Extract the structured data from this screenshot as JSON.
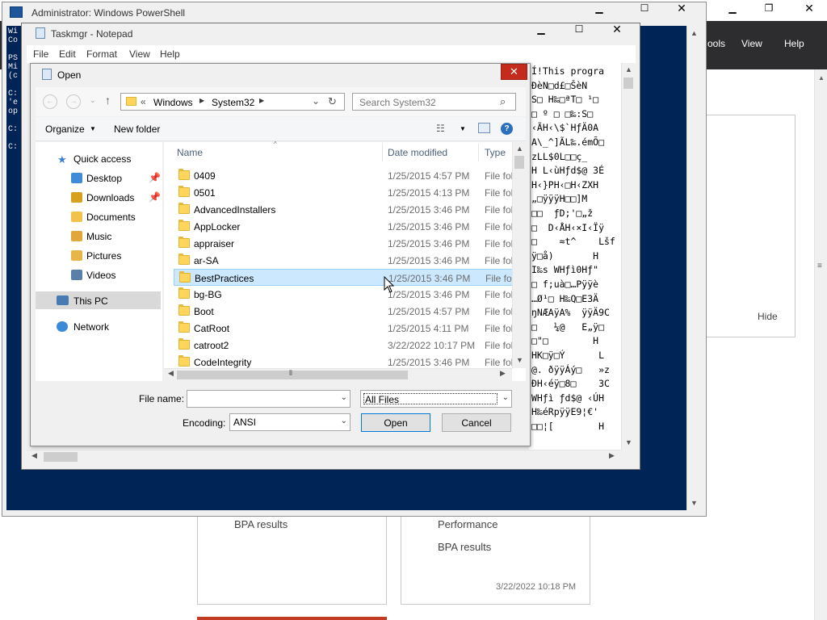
{
  "server_manager": {
    "menu": [
      "ools",
      "View",
      "Help"
    ],
    "hide_label": "Hide",
    "tile1": [
      "BPA results"
    ],
    "tile2": [
      "Performance",
      "BPA results"
    ],
    "tile2_time": "3/22/2022 10:18 PM"
  },
  "powershell": {
    "title": "Administrator: Windows PowerShell",
    "lines": [
      "Wi",
      "Co",
      "",
      "PS",
      "Mi",
      "(c",
      "",
      "C:",
      "'e",
      "op",
      "",
      "C:",
      "",
      "C:"
    ]
  },
  "notepad": {
    "title": "Taskmgr - Notepad",
    "menu": [
      "File",
      "Edit",
      "Format",
      "View",
      "Help"
    ],
    "text_lines": [
      "Í!This progra",
      "ÐèN□d£□ŠèN",
      "S□ H‰□ªT□ ¹□",
      "□ º □ □‰:S□",
      "‹ÃH‹\\$`HƒÄ0A",
      "A\\_^]ÃL‰.émÕ□",
      "zLL$0L□□ç_",
      "H L‹ùHƒd$@ 3É",
      "H‹}PH‹□H‹ZXH",
      "„□ÿÿÿH□□]M",
      "□□  ƒD;'□„ž",
      "□  D‹ÅH‹×I‹Ïÿ",
      "□    ≈t^    Lšf",
      "ÿ□å)       H",
      "I‰s WHƒì0Hƒ\"",
      "□ f;uà□…Pÿÿè",
      "…Ø¹□ H‰Q□E3Ä",
      "ŋNÆAÿA%  ÿÿÄ9C",
      "□   ¼@   E„ÿ□",
      "□\"□        H",
      "HK□ÿ□Ý      L",
      "@. ðÿÿÁý□   »z",
      "ÐH‹éÿ□8□    3C",
      "WHƒì ƒd$@ ‹ÚH",
      "H‰éRpÿÿE9¦€'",
      "□□¦[        H"
    ]
  },
  "open_dialog": {
    "title": "Open",
    "breadcrumb": [
      "«",
      "Windows",
      "System32"
    ],
    "search_placeholder": "Search System32",
    "organize_label": "Organize",
    "new_folder_label": "New folder",
    "columns": {
      "name": "Name",
      "date": "Date modified",
      "type": "Type"
    },
    "nav": {
      "quick_access": "Quick access",
      "desktop": "Desktop",
      "downloads": "Downloads",
      "documents": "Documents",
      "music": "Music",
      "pictures": "Pictures",
      "videos": "Videos",
      "this_pc": "This PC",
      "network": "Network"
    },
    "files": [
      {
        "name": "0409",
        "date": "1/25/2015 4:57 PM",
        "type": "File folder"
      },
      {
        "name": "0501",
        "date": "1/25/2015 4:13 PM",
        "type": "File folder"
      },
      {
        "name": "AdvancedInstallers",
        "date": "1/25/2015 3:46 PM",
        "type": "File folder"
      },
      {
        "name": "AppLocker",
        "date": "1/25/2015 3:46 PM",
        "type": "File folder"
      },
      {
        "name": "appraiser",
        "date": "1/25/2015 3:46 PM",
        "type": "File folder"
      },
      {
        "name": "ar-SA",
        "date": "1/25/2015 3:46 PM",
        "type": "File folder"
      },
      {
        "name": "BestPractices",
        "date": "1/25/2015 3:46 PM",
        "type": "File folder",
        "selected": true
      },
      {
        "name": "bg-BG",
        "date": "1/25/2015 3:46 PM",
        "type": "File folder"
      },
      {
        "name": "Boot",
        "date": "1/25/2015 4:57 PM",
        "type": "File folder"
      },
      {
        "name": "CatRoot",
        "date": "1/25/2015 4:11 PM",
        "type": "File folder"
      },
      {
        "name": "catroot2",
        "date": "3/22/2022 10:17 PM",
        "type": "File folder"
      },
      {
        "name": "CodeIntegrity",
        "date": "1/25/2015 3:46 PM",
        "type": "File folder"
      }
    ],
    "file_name_label": "File name:",
    "file_name_value": "",
    "file_type_value": "All Files",
    "encoding_label": "Encoding:",
    "encoding_value": "ANSI",
    "open_label": "Open",
    "cancel_label": "Cancel"
  }
}
